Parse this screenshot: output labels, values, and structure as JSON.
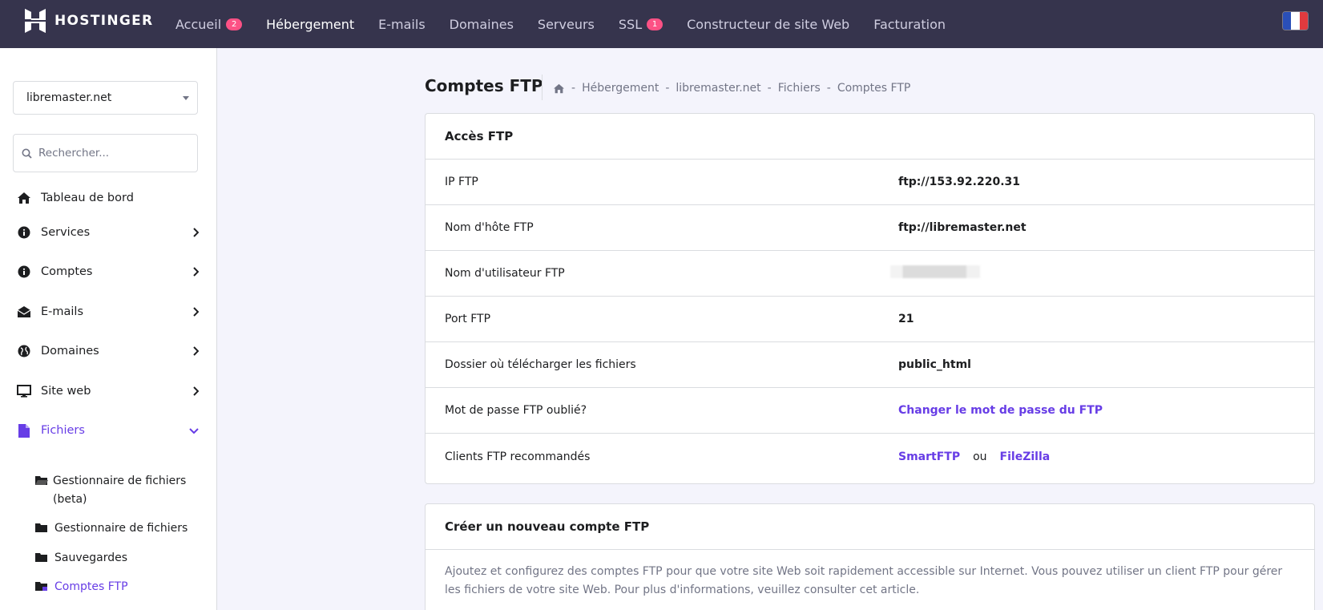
{
  "brand": {
    "name": "HOSTINGER"
  },
  "nav": [
    {
      "label": "Accueil",
      "badge": "2"
    },
    {
      "label": "Hébergement",
      "active": true
    },
    {
      "label": "E-mails"
    },
    {
      "label": "Domaines"
    },
    {
      "label": "Serveurs"
    },
    {
      "label": "SSL",
      "badge": "1"
    },
    {
      "label": "Constructeur de site Web"
    },
    {
      "label": "Facturation"
    }
  ],
  "sidebar": {
    "domain": "libremaster.net",
    "search_placeholder": "Rechercher...",
    "items": [
      {
        "label": "Tableau de bord",
        "icon": "home-icon"
      },
      {
        "label": "Services",
        "icon": "info-icon"
      },
      {
        "label": "Comptes",
        "icon": "info-icon"
      },
      {
        "label": "E-mails",
        "icon": "envelope-icon"
      },
      {
        "label": "Domaines",
        "icon": "globe-icon"
      },
      {
        "label": "Site web",
        "icon": "monitor-icon"
      },
      {
        "label": "Fichiers",
        "icon": "file-icon",
        "active": true
      }
    ],
    "subitems": [
      {
        "label": "Gestionnaire de fichiers (beta)",
        "icon": "folder-open-icon"
      },
      {
        "label": "Gestionnaire de fichiers",
        "icon": "folder-icon"
      },
      {
        "label": "Sauvegardes",
        "icon": "folder-icon"
      },
      {
        "label": "Comptes FTP",
        "icon": "ftp-folder-icon",
        "active": true
      }
    ]
  },
  "page": {
    "title": "Comptes FTP",
    "breadcrumb": [
      "Hébergement",
      "libremaster.net",
      "Fichiers",
      "Comptes FTP"
    ]
  },
  "ftp_access": {
    "title": "Accès FTP",
    "rows": [
      {
        "label": "IP FTP",
        "value": "ftp://153.92.220.31"
      },
      {
        "label": "Nom d'hôte FTP",
        "value": "ftp://libremaster.net"
      },
      {
        "label": "Nom d'utilisateur FTP",
        "value": ""
      },
      {
        "label": "Port FTP",
        "value": "21"
      },
      {
        "label": "Dossier où télécharger les fichiers",
        "value": "public_html"
      },
      {
        "label": "Mot de passe FTP oublié?",
        "value": "Changer le mot de passe du FTP"
      },
      {
        "label": "Clients FTP recommandés",
        "client1": "SmartFTP",
        "separator": "ou",
        "client2": "FileZilla"
      }
    ]
  },
  "new_account": {
    "title": "Créer un nouveau compte FTP",
    "description": "Ajoutez et configurez des comptes FTP pour que votre site Web soit rapidement accessible sur Internet. Vous pouvez utiliser un client FTP pour gérer les fichiers de votre site Web. Pour plus d'informations, veuillez consulter cet article."
  },
  "colors": {
    "topbar": "#36344d",
    "accent": "#673de6",
    "badge": "#fc5185"
  }
}
